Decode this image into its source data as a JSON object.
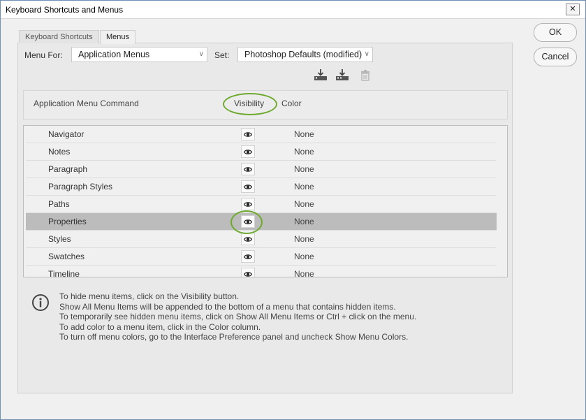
{
  "window": {
    "title": "Keyboard Shortcuts and Menus",
    "close_glyph": "✕"
  },
  "tabs": [
    {
      "label": "Keyboard Shortcuts",
      "active": false
    },
    {
      "label": "Menus",
      "active": true
    }
  ],
  "menu_for": {
    "label": "Menu For:",
    "value": "Application Menus"
  },
  "set": {
    "label": "Set:",
    "value": "Photoshop Defaults (modified)"
  },
  "toolbar": {
    "icons": [
      "save-set-icon",
      "save-set-as-icon",
      "delete-set-icon"
    ]
  },
  "table": {
    "columns": {
      "command": "Application Menu Command",
      "visibility": "Visibility",
      "color": "Color"
    },
    "rows": [
      {
        "name": "Navigator",
        "visible": true,
        "color": "None",
        "selected": false
      },
      {
        "name": "Notes",
        "visible": true,
        "color": "None",
        "selected": false
      },
      {
        "name": "Paragraph",
        "visible": true,
        "color": "None",
        "selected": false
      },
      {
        "name": "Paragraph Styles",
        "visible": true,
        "color": "None",
        "selected": false
      },
      {
        "name": "Paths",
        "visible": true,
        "color": "None",
        "selected": false
      },
      {
        "name": "Properties",
        "visible": true,
        "color": "None",
        "selected": true
      },
      {
        "name": "Styles",
        "visible": true,
        "color": "None",
        "selected": false
      },
      {
        "name": "Swatches",
        "visible": true,
        "color": "None",
        "selected": false
      },
      {
        "name": "Timeline",
        "visible": true,
        "color": "None",
        "selected": false
      }
    ]
  },
  "info": {
    "lines": [
      "To hide menu items, click on the Visibility button.",
      "Show All Menu Items will be appended to the bottom of a menu that contains hidden items.",
      "To temporarily see hidden menu items, click on Show All Menu Items or Ctrl + click on the menu.",
      "To add color to a menu item, click in the Color column.",
      "To turn off menu colors, go to the Interface Preference panel and uncheck Show Menu Colors."
    ]
  },
  "buttons": {
    "ok": "OK",
    "cancel": "Cancel"
  },
  "colors": {
    "highlight_ring": "#6eaa2f",
    "selected_row": "#bcbcbc"
  }
}
